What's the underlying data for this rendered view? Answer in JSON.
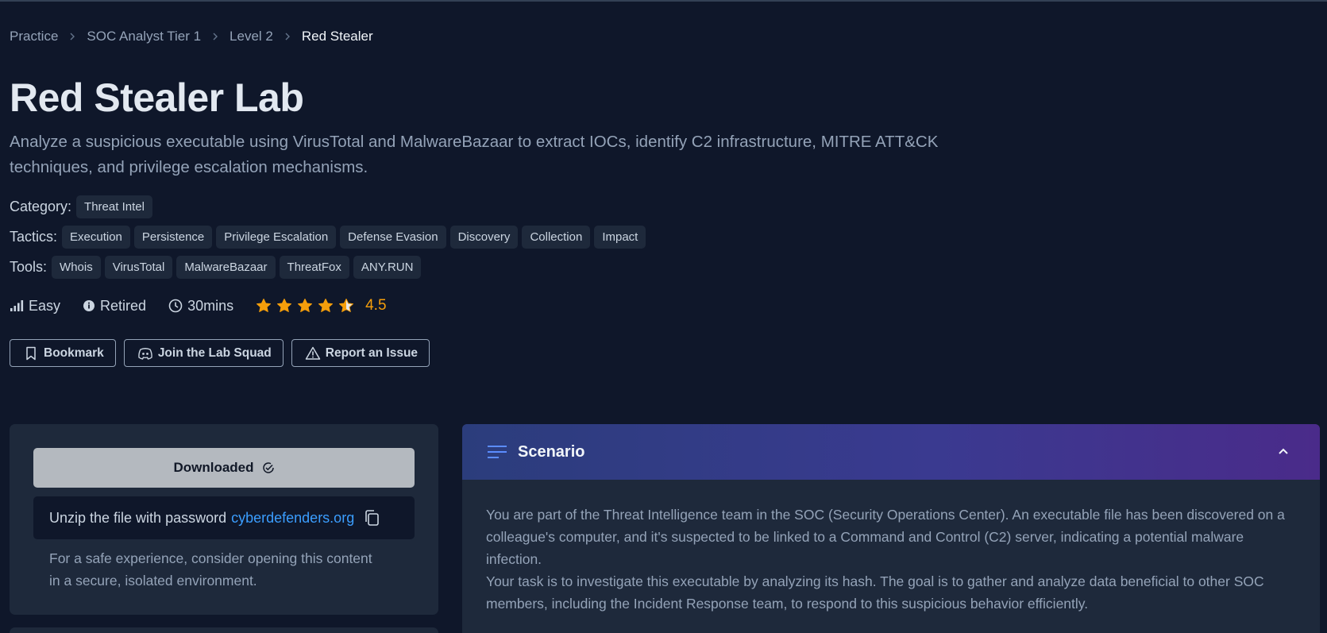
{
  "breadcrumb": [
    "Practice",
    "SOC Analyst Tier 1",
    "Level 2",
    "Red Stealer"
  ],
  "title": "Red Stealer Lab",
  "description": "Analyze a suspicious executable using VirusTotal and MalwareBazaar to extract IOCs, identify C2 infrastructure, MITRE ATT&CK techniques, and privilege escalation mechanisms.",
  "category": {
    "label": "Category:",
    "tags": [
      "Threat Intel"
    ]
  },
  "tactics": {
    "label": "Tactics:",
    "tags": [
      "Execution",
      "Persistence",
      "Privilege Escalation",
      "Defense Evasion",
      "Discovery",
      "Collection",
      "Impact"
    ]
  },
  "tools": {
    "label": "Tools:",
    "tags": [
      "Whois",
      "VirusTotal",
      "MalwareBazaar",
      "ThreatFox",
      "ANY.RUN"
    ]
  },
  "meta": {
    "difficulty": "Easy",
    "status": "Retired",
    "duration": "30mins",
    "rating": "4.5",
    "rating_value": 4.5,
    "star_color": "#f59e0b"
  },
  "actions": {
    "bookmark": "Bookmark",
    "join": "Join the Lab Squad",
    "report": "Report an Issue"
  },
  "download": {
    "button": "Downloaded",
    "password_text": "Unzip the file with password",
    "password": "cyberdefenders.org",
    "safe_note": "For a safe experience, consider opening this content in a secure, isolated environment."
  },
  "scenario": {
    "title": "Scenario",
    "paragraphs": [
      "You are part of the Threat Intelligence team in the SOC (Security Operations Center). An executable file has been discovered on a colleague's computer, and it's suspected to be linked to a Command and Control (C2) server, indicating a potential malware infection.",
      "Your task is to investigate this executable by analyzing its hash. The goal is to gather and analyze data beneficial to other SOC members, including the Incident Response team, to respond to this suspicious behavior efficiently."
    ]
  }
}
